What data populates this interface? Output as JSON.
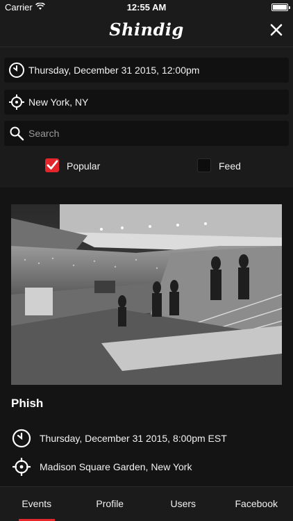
{
  "status_bar": {
    "carrier": "Carrier",
    "time": "12:55 AM"
  },
  "navbar": {
    "title": "Shindig",
    "close_icon": "close-icon"
  },
  "filters": {
    "date_value": "Thursday, December 31 2015, 12:00pm",
    "location_value": "New York, NY",
    "search_placeholder": "Search",
    "popular_label": "Popular",
    "popular_checked": true,
    "feed_label": "Feed",
    "feed_checked": false
  },
  "event": {
    "image_description_icon": "concert-photo",
    "title": "Phish",
    "datetime": "Thursday, December 31 2015, 8:00pm EST",
    "venue": "Madison Square Garden, New York"
  },
  "tabs": [
    {
      "label": "Events",
      "active": true
    },
    {
      "label": "Profile",
      "active": false
    },
    {
      "label": "Users",
      "active": false
    },
    {
      "label": "Facebook",
      "active": false
    }
  ],
  "colors": {
    "accent": "#e2262c",
    "background": "#1b1b1b",
    "field_background": "#111111"
  }
}
